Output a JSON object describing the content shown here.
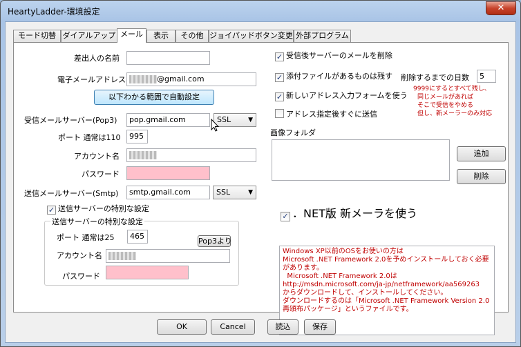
{
  "window": {
    "title": "HeartyLadder-環境設定",
    "close_label": "✕"
  },
  "tabs": [
    {
      "label": "モード切替"
    },
    {
      "label": "ダイアルアップ"
    },
    {
      "label": "メール"
    },
    {
      "label": "表示"
    },
    {
      "label": "その他"
    },
    {
      "label": "ジョイパッドボタン変更"
    },
    {
      "label": "外部プログラム"
    }
  ],
  "left": {
    "sender_name_label": "差出人の名前",
    "sender_name_value": "",
    "email_label": "電子メールアドレス",
    "email_value": "@gmail.com",
    "auto_config_button": "以下わかる範囲で自動設定",
    "pop3_label": "受信メールサーバー(Pop3)",
    "pop3_value": "pop.gmail.com",
    "pop3_security": "SSL",
    "port_label": "ポート  通常は110",
    "port_value": "995",
    "account_label": "アカウント名",
    "password_label": "パスワード",
    "smtp_label": "送信メールサーバー(Smtp)",
    "smtp_value": "smtp.gmail.com",
    "smtp_security": "SSL",
    "smtp_special_checkbox": "送信サーバーの特別な設定",
    "smtp_group_title": "送信サーバーの特別な設定",
    "smtp_port_label": "ポート  通常は25",
    "smtp_port_value": "465",
    "from_pop3_button": "Pop3より",
    "smtp_account_label": "アカウント名",
    "smtp_password_label": "パスワード"
  },
  "right": {
    "delete_after_receive": "受信後サーバーのメールを削除",
    "keep_attachments": "添付ファイルがあるものは残す",
    "days_label": "削除するまでの日数",
    "days_value": "5",
    "new_address_form": "新しいアドレス入力フォームを使う",
    "send_after_address": "アドレス指定後すぐに送信",
    "note_lines": [
      "9999にするとすべて残し、",
      "同じメールがあれば",
      "そこで受信をやめる",
      "但し、新メーラーのみ対応"
    ],
    "image_folder_label": "画像フォルダ",
    "add_button": "追加",
    "delete_button": "削除",
    "net_checkbox": "．NET版  新メーラを使う",
    "net_text": [
      "Windows XP以前のOSをお使いの方は",
      "Microsoft .NET Framework 2.0を予めインストールしておく必要があります。",
      "  Microsoft .NET Framework 2.0は",
      "http://msdn.microsoft.com/ja-jp/netframework/aa569263",
      "からダウンロードして、インストールしてください。",
      "ダウンロードするのは「Microsoft .NET Framework Version 2.0 再頒布パッケージ」というファイルです。"
    ]
  },
  "bottom": {
    "ok": "OK",
    "cancel": "Cancel",
    "load": "読込",
    "save": "保存"
  }
}
